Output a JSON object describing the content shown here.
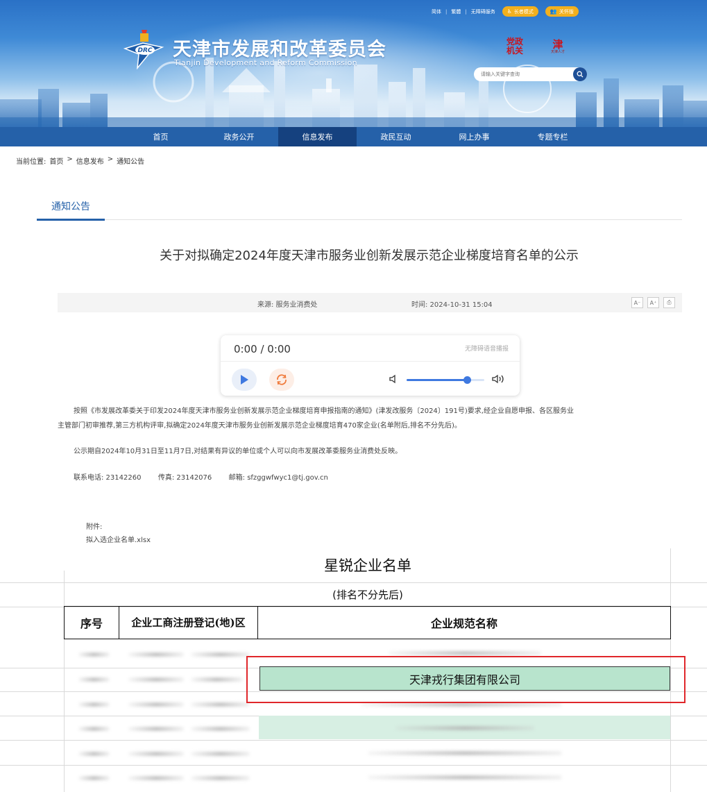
{
  "header": {
    "top_links": [
      "简体",
      "繁體",
      "无障碍服务"
    ],
    "care_mode": "长者模式",
    "care_mode_icon": "elder-icon",
    "care_band": "关怀版",
    "care_band_icon": "people-icon",
    "title_cn": "天津市发展和改革委员会",
    "title_en": "Tianjin Development and Reform Commission",
    "logo_text": "DRC",
    "badge1_lines": [
      "党政",
      "机关"
    ],
    "badge2_lines": [
      "津",
      "天津人才"
    ],
    "search_placeholder": "请输入关键字查询",
    "search_icon": "search-icon",
    "colors": {
      "nav": "#2561a9",
      "nav_active": "#15417f",
      "accent": "#2561a9",
      "pill": "#f2b01e",
      "highlight": "#b8e4cd",
      "red_box": "#e0262a"
    }
  },
  "nav": {
    "items": [
      "首页",
      "政务公开",
      "信息发布",
      "政民互动",
      "网上办事",
      "专题专栏"
    ],
    "active_index": 2
  },
  "breadcrumb": {
    "prefix": "当前位置:",
    "items": [
      "首页",
      "信息发布",
      "通知公告"
    ],
    "separator": ">"
  },
  "section": {
    "tab": "通知公告"
  },
  "article": {
    "title": "关于对拟确定2024年度天津市服务业创新发展示范企业梯度培育名单的公示",
    "source": "来源: 服务业消费处",
    "time": "时间: 2024-10-31 15:04",
    "tools": [
      "A⁻",
      "A⁺",
      "⎙"
    ]
  },
  "player": {
    "time": "0:00 / 0:00",
    "label": "无障碍语音播报",
    "volume_fraction": 0.78
  },
  "body": {
    "p1_line1": "按照《市发展改革委关于印发2024年度天津市服务业创新发展示范企业梯度培育申报指南的通知》(津发改服务〔2024〕191号)要求,经企业自愿申报、各区服务业",
    "p1_line2": "主管部门初审推荐,第三方机构评审,拟确定2024年度天津市服务业创新发展示范企业梯度培育470家企业(名单附后,排名不分先后)。",
    "p2": "公示期自2024年10月31日至11月7日,对结果有异议的单位或个人可以向市发展改革委服务业消费处反映。",
    "p3_phone": "联系电话: 23142260",
    "p3_fax": "传真: 23142076",
    "p3_email": "邮箱: sfzggwfwyc1@tj.gov.cn",
    "attach_label": "附件:",
    "attach_file": "拟入选企业名单.xlsx"
  },
  "sheet": {
    "title": "星锐企业名单",
    "subtitle": "(排名不分先后)",
    "headers": [
      "序号",
      "企业工商注册登记(地)区",
      "企业规范名称"
    ],
    "highlighted_company": "天津戎行集团有限公司"
  }
}
